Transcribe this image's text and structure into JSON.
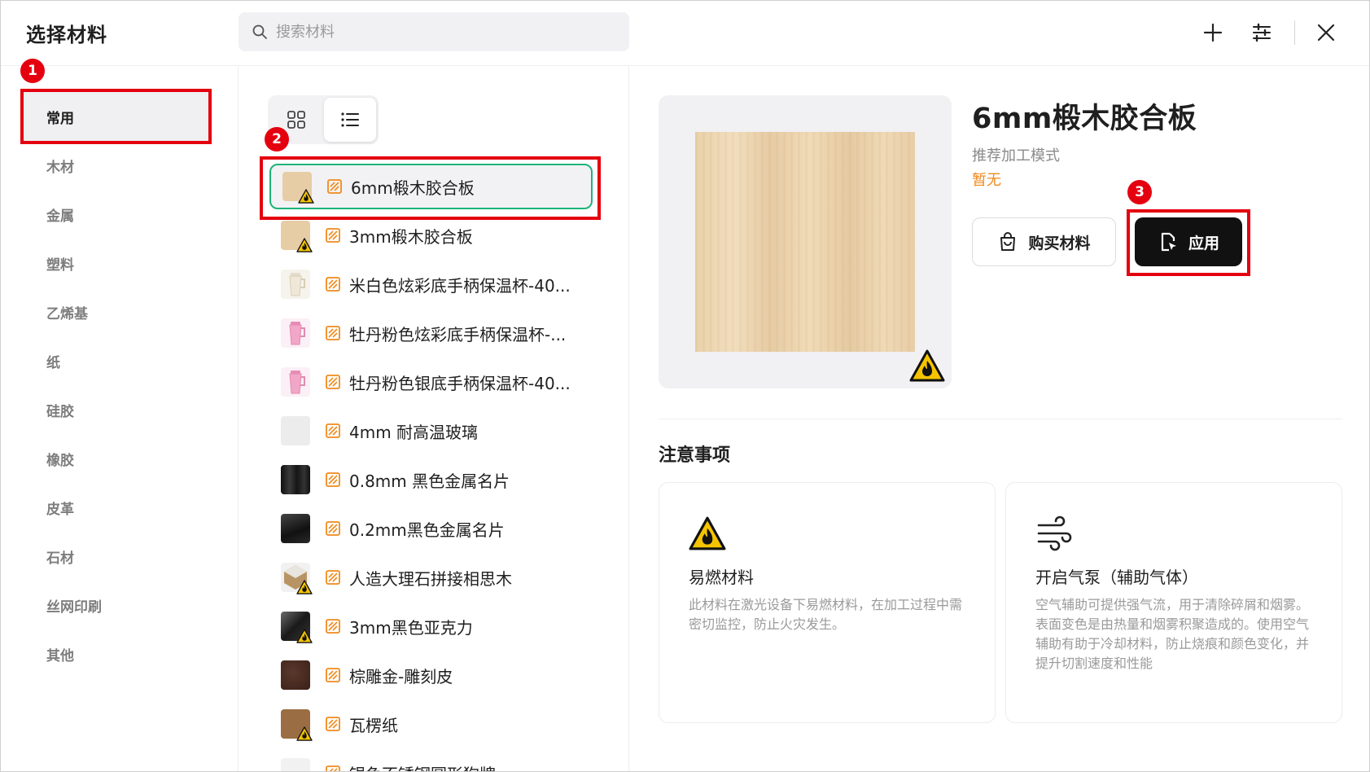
{
  "header": {
    "title": "选择材料",
    "search_placeholder": "搜索材料"
  },
  "sidebar": {
    "categories": [
      {
        "label": "常用",
        "active": true
      },
      {
        "label": "木材"
      },
      {
        "label": "金属"
      },
      {
        "label": "塑料"
      },
      {
        "label": "乙烯基"
      },
      {
        "label": "纸"
      },
      {
        "label": "硅胶"
      },
      {
        "label": "橡胶"
      },
      {
        "label": "皮革"
      },
      {
        "label": "石材"
      },
      {
        "label": "丝网印刷"
      },
      {
        "label": "其他"
      }
    ]
  },
  "materials": [
    {
      "name": "6mm椴木胶合板",
      "color": "#e6cda6",
      "warn": true,
      "selected": true
    },
    {
      "name": "3mm椴木胶合板",
      "color": "#e6cda6",
      "warn": true
    },
    {
      "name": "米白色炫彩底手柄保温杯-40...",
      "color": "#f3efe4"
    },
    {
      "name": "牡丹粉色炫彩底手柄保温杯-...",
      "color": "#f2a6c8"
    },
    {
      "name": "牡丹粉色银底手柄保温杯-40...",
      "color": "#f2a6c8"
    },
    {
      "name": "4mm 耐高温玻璃",
      "color": "#ebebeb"
    },
    {
      "name": "0.8mm 黑色金属名片",
      "color": "#1e1e1e"
    },
    {
      "name": "0.2mm黑色金属名片",
      "color": "#252525"
    },
    {
      "name": "人造大理石拼接相思木",
      "color": "#b89464",
      "warn": true
    },
    {
      "name": "3mm黑色亚克力",
      "color": "#2b2b2b",
      "warn": true
    },
    {
      "name": "棕雕金-雕刻皮",
      "color": "#4a2b22"
    },
    {
      "name": "瓦楞纸",
      "color": "#9a6d42",
      "warn": true
    },
    {
      "name": "银色不锈钢圆形狗牌",
      "color": "#cfcfcf"
    }
  ],
  "detail": {
    "title": "6mm椴木胶合板",
    "subtitle": "推荐加工模式",
    "mode_value": "暂无",
    "buy_label": "购买材料",
    "apply_label": "应用",
    "notes_title": "注意事项",
    "notes": [
      {
        "title": "易燃材料",
        "desc": "此材料在激光设备下易燃材料，在加工过程中需密切监控，防止火灾发生。",
        "icon": "flammable-icon"
      },
      {
        "title": "开启气泵（辅助气体）",
        "desc": "空气辅助可提供强气流，用于清除碎屑和烟雾。表面变色是由热量和烟雾积聚造成的。使用空气辅助有助于冷却材料，防止烧痕和颜色变化，并提升切割速度和性能",
        "icon": "air-assist-icon"
      }
    ]
  },
  "annotations": {
    "badge1": "1",
    "badge2": "2",
    "badge3": "3"
  },
  "colors": {
    "accent_green": "#1db47a",
    "annotation_red": "#e4000f",
    "mode_orange": "#f08a1c"
  }
}
